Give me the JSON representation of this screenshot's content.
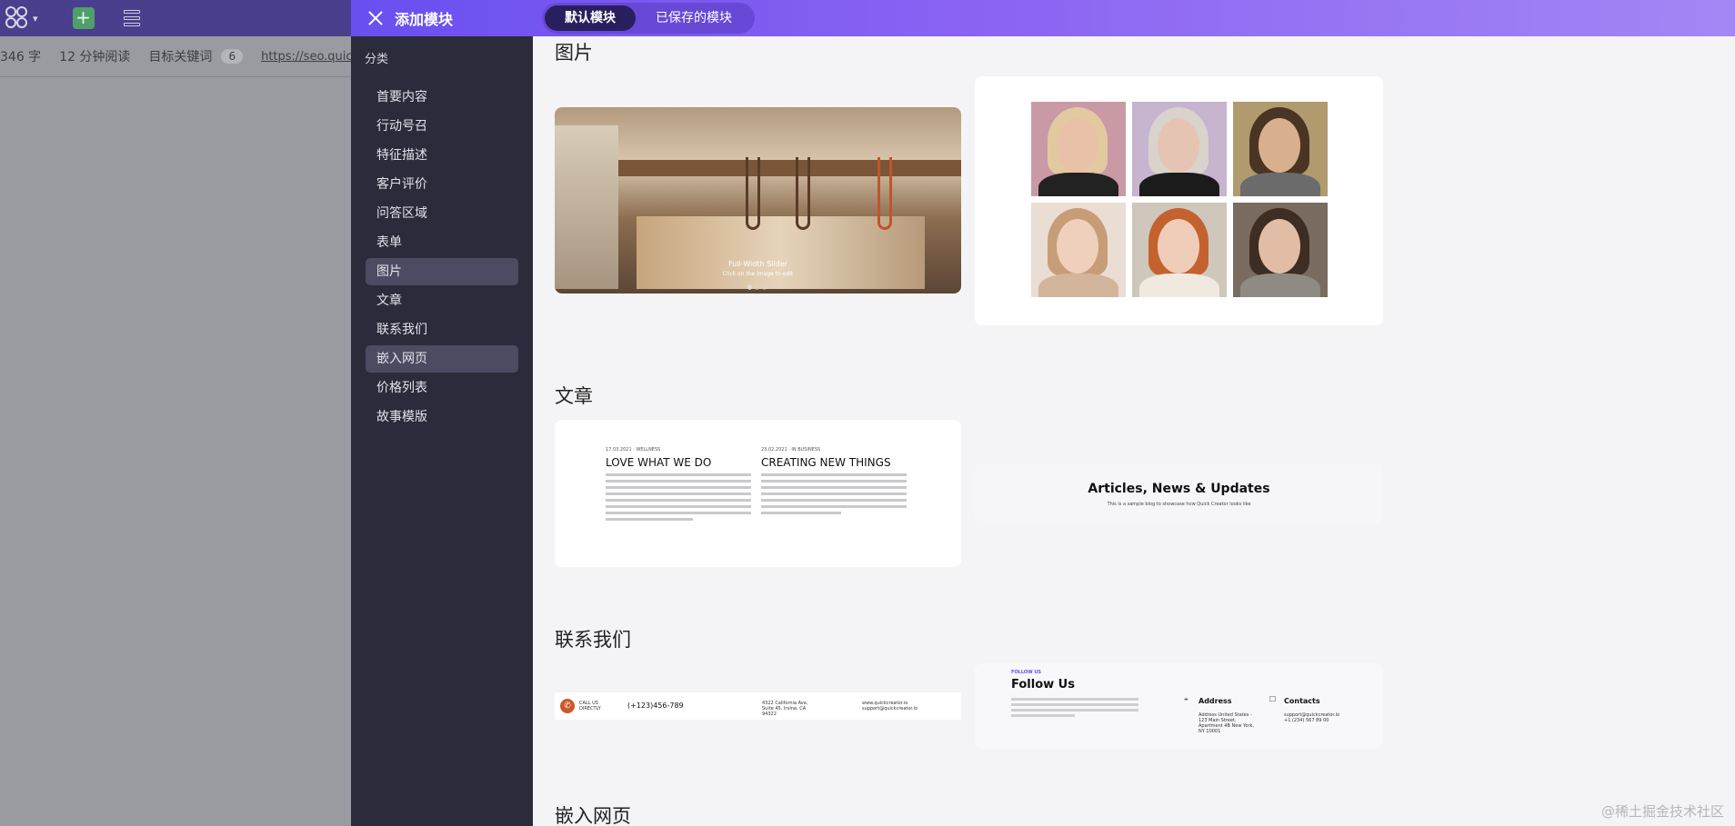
{
  "editor": {
    "word_count": "346 字",
    "read_time": "12 分钟阅读",
    "keyword_label": "目标关键词",
    "keyword_count": "6",
    "url": "https://seo.quickcre"
  },
  "modal": {
    "title": "添加模块",
    "tabs": [
      {
        "label": "默认模块",
        "active": true
      },
      {
        "label": "已保存的模块",
        "active": false
      }
    ]
  },
  "sidebar": {
    "heading": "分类",
    "items": [
      {
        "label": "首要内容"
      },
      {
        "label": "行动号召"
      },
      {
        "label": "特征描述"
      },
      {
        "label": "客户评价"
      },
      {
        "label": "问答区域"
      },
      {
        "label": "表单"
      },
      {
        "label": "图片",
        "active": true
      },
      {
        "label": "文章"
      },
      {
        "label": "联系我们"
      },
      {
        "label": "嵌入网页",
        "active": true
      },
      {
        "label": "价格列表"
      },
      {
        "label": "故事模版"
      }
    ]
  },
  "sections": {
    "images": {
      "title": "图片",
      "slider_caption": "Full-Width Slider",
      "slider_sub": "Click on the image to edit",
      "slider_dots": "●○○"
    },
    "articles": {
      "title": "文章",
      "col1_meta": "17.03.2021 · WELLNESS",
      "col1_head": "LOVE WHAT WE DO",
      "col2_meta": "23.02.2021 · IN BUSINESS",
      "col2_head": "CREATING NEW THINGS",
      "banner_title": "Articles, News & Updates",
      "banner_sub": "This is a sample blog to showcase how Quick Creator looks like"
    },
    "contact": {
      "title": "联系我们",
      "call_label": "CALL US DIRECTLY",
      "phone": "(+123)456-789",
      "address_short": "4322 California Ave, Suite 45, Irvine, CA 94322",
      "emails_short": "www.quickcreator.io support@quickcreator.io",
      "follow_label": "FOLLOW US",
      "follow_title": "Follow Us",
      "address_h": "Address",
      "address_body": "Address United States - 123 Main Street, Apartment 4B New York, NY 10001",
      "contacts_h": "Contacts",
      "contacts_body": "support@quickcreator.io +1 (234) 567 89 00"
    },
    "embed": {
      "title": "嵌入网页"
    }
  },
  "watermark": "@稀土掘金技术社区"
}
